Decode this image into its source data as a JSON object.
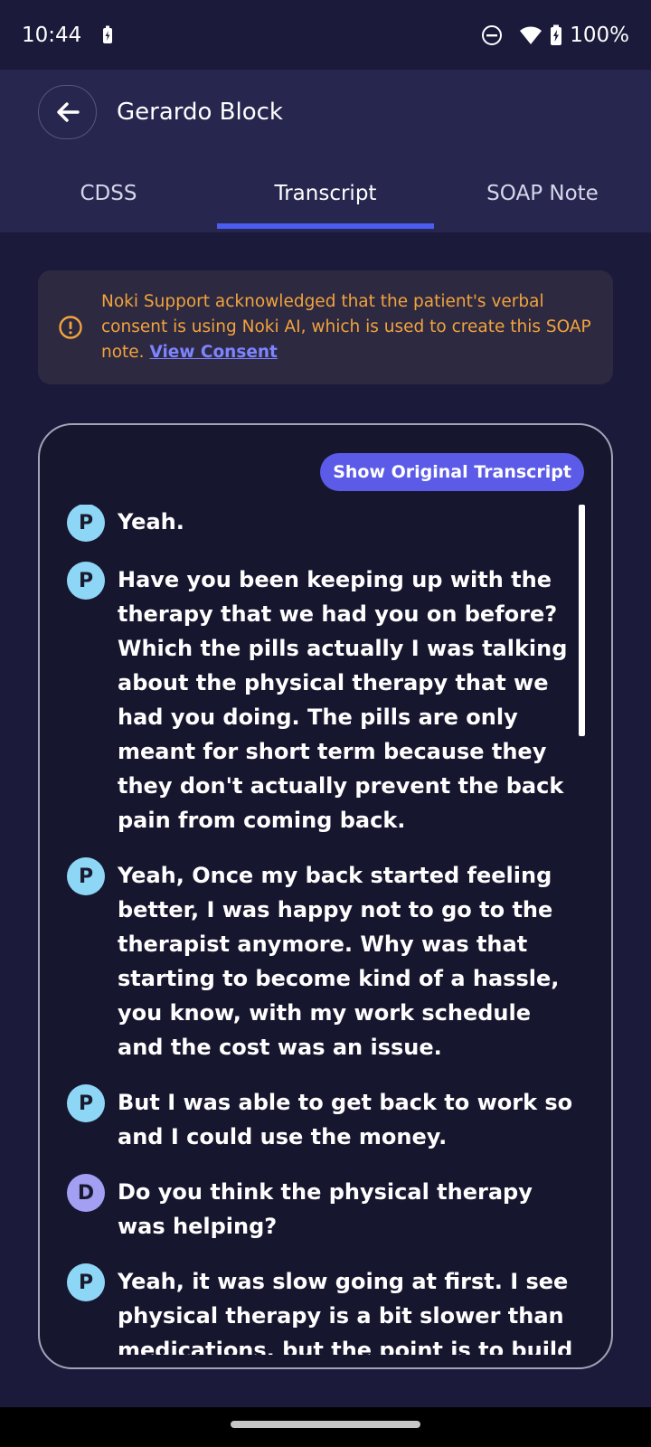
{
  "status": {
    "time": "10:44",
    "battery": "100%"
  },
  "header": {
    "title": "Gerardo Block"
  },
  "tabs": [
    {
      "label": "CDSS"
    },
    {
      "label": "Transcript"
    },
    {
      "label": "SOAP Note"
    }
  ],
  "consent": {
    "text": "Noki Support acknowledged that the patient's verbal consent is using Noki AI, which is used to create this SOAP note.",
    "link": "View Consent"
  },
  "transcript": {
    "show_original_label": "Show Original Transcript",
    "messages": [
      {
        "speaker": "P",
        "text": "Yeah."
      },
      {
        "speaker": "P",
        "text": "Have you been keeping up with the therapy that we had you on before? Which the pills actually I was talking about the physical therapy that we had you doing. The pills are only meant for short term because they they don't actually prevent the back pain from coming back."
      },
      {
        "speaker": "P",
        "text": "Yeah, Once my back started feeling better, I was happy not to go to the therapist anymore. Why was that starting to become kind of a hassle, you know, with my work schedule and the cost was an issue."
      },
      {
        "speaker": "P",
        "text": "But I was able to get back to work so and I could use the money."
      },
      {
        "speaker": "D",
        "text": "Do you think the physical therapy was helping?"
      },
      {
        "speaker": "P",
        "text": "Yeah, it was slow going at first. I see physical therapy is a bit slower than medications, but the point is to build"
      }
    ]
  },
  "colors": {
    "accent": "#4b5cf0",
    "warning": "#f2a33c",
    "patient_avatar": "#8ed6f6",
    "doctor_avatar": "#a39ff2"
  }
}
